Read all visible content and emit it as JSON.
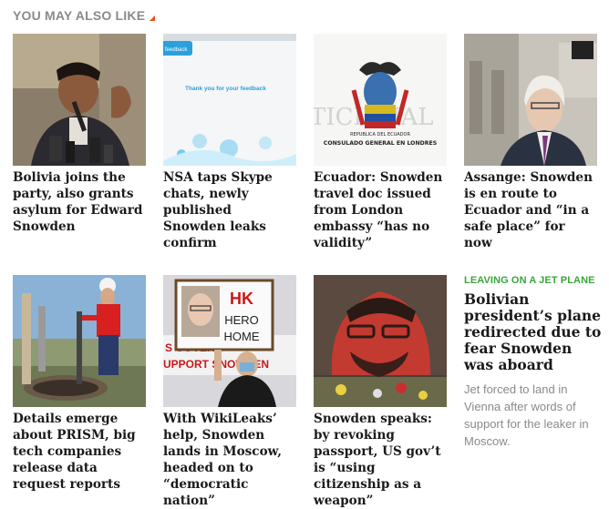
{
  "header": {
    "title": "YOU MAY ALSO LIKE"
  },
  "cards": [
    {
      "caption": "Bolivia joins the party, also grants asylum for Edward Snowden",
      "image_icon": "bolivia-president-photo"
    },
    {
      "caption": "NSA taps Skype chats, newly published Snowden leaks confirm",
      "image_icon": "skype-feedback-screenshot",
      "image_texts": {
        "top": "feedback",
        "main": "Thank you for your feedback"
      }
    },
    {
      "caption": "Ecuador: Snowden travel doc issued from London embassy “has no validity”",
      "image_icon": "ecuador-consulate-sign",
      "image_texts": {
        "line1": "REPUBLICA DEL ECUADOR",
        "line2": "CONSULADO GENERAL EN LONDRES",
        "bg": "TICIENAL"
      }
    },
    {
      "caption": "Assange: Snowden is en route to Ecuador and “in a safe place” for now",
      "image_icon": "assange-photo"
    },
    {
      "caption": "Details emerge about PRISM, big tech companies release data request reports",
      "image_icon": "worker-pipe-photo"
    },
    {
      "caption": "With WikiLeaks’ help, Snowden lands in Moscow, headed on to “democratic nation”",
      "image_icon": "hk-protest-photo",
      "image_texts": {
        "sign1": "HK",
        "sign2": "HERO",
        "sign3": "HOME",
        "banner1": "S GOVERN",
        "banner2": "UPPORT SNOWDEN"
      }
    },
    {
      "caption": "Snowden speaks: by revoking passport, US gov’t is “using citizenship as a weapon”",
      "image_icon": "snowden-mural-photo"
    }
  ],
  "promo": {
    "kicker": "LEAVING ON A JET PLANE",
    "title": "Bolivian president’s plane redirected due to fear Snowden was aboard",
    "description": "Jet forced to land in Vienna after words of support for the leaker in Moscow."
  },
  "colors": {
    "accent": "#e8501a",
    "kicker": "#3aa53a",
    "text": "#1a1a1a",
    "muted": "#8a8a8a"
  }
}
